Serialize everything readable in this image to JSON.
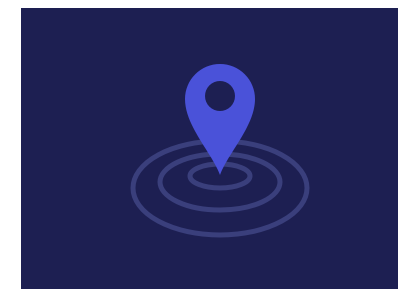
{
  "scene": {
    "background_color": "#1d1f52",
    "page_color": "#ffffff",
    "icon": "location-pin-icon",
    "pin_color": "#4a52d9",
    "pin_hole_color": "#1d1f52",
    "ripple_color": "#3a3f7c",
    "ripple_count": 3
  }
}
